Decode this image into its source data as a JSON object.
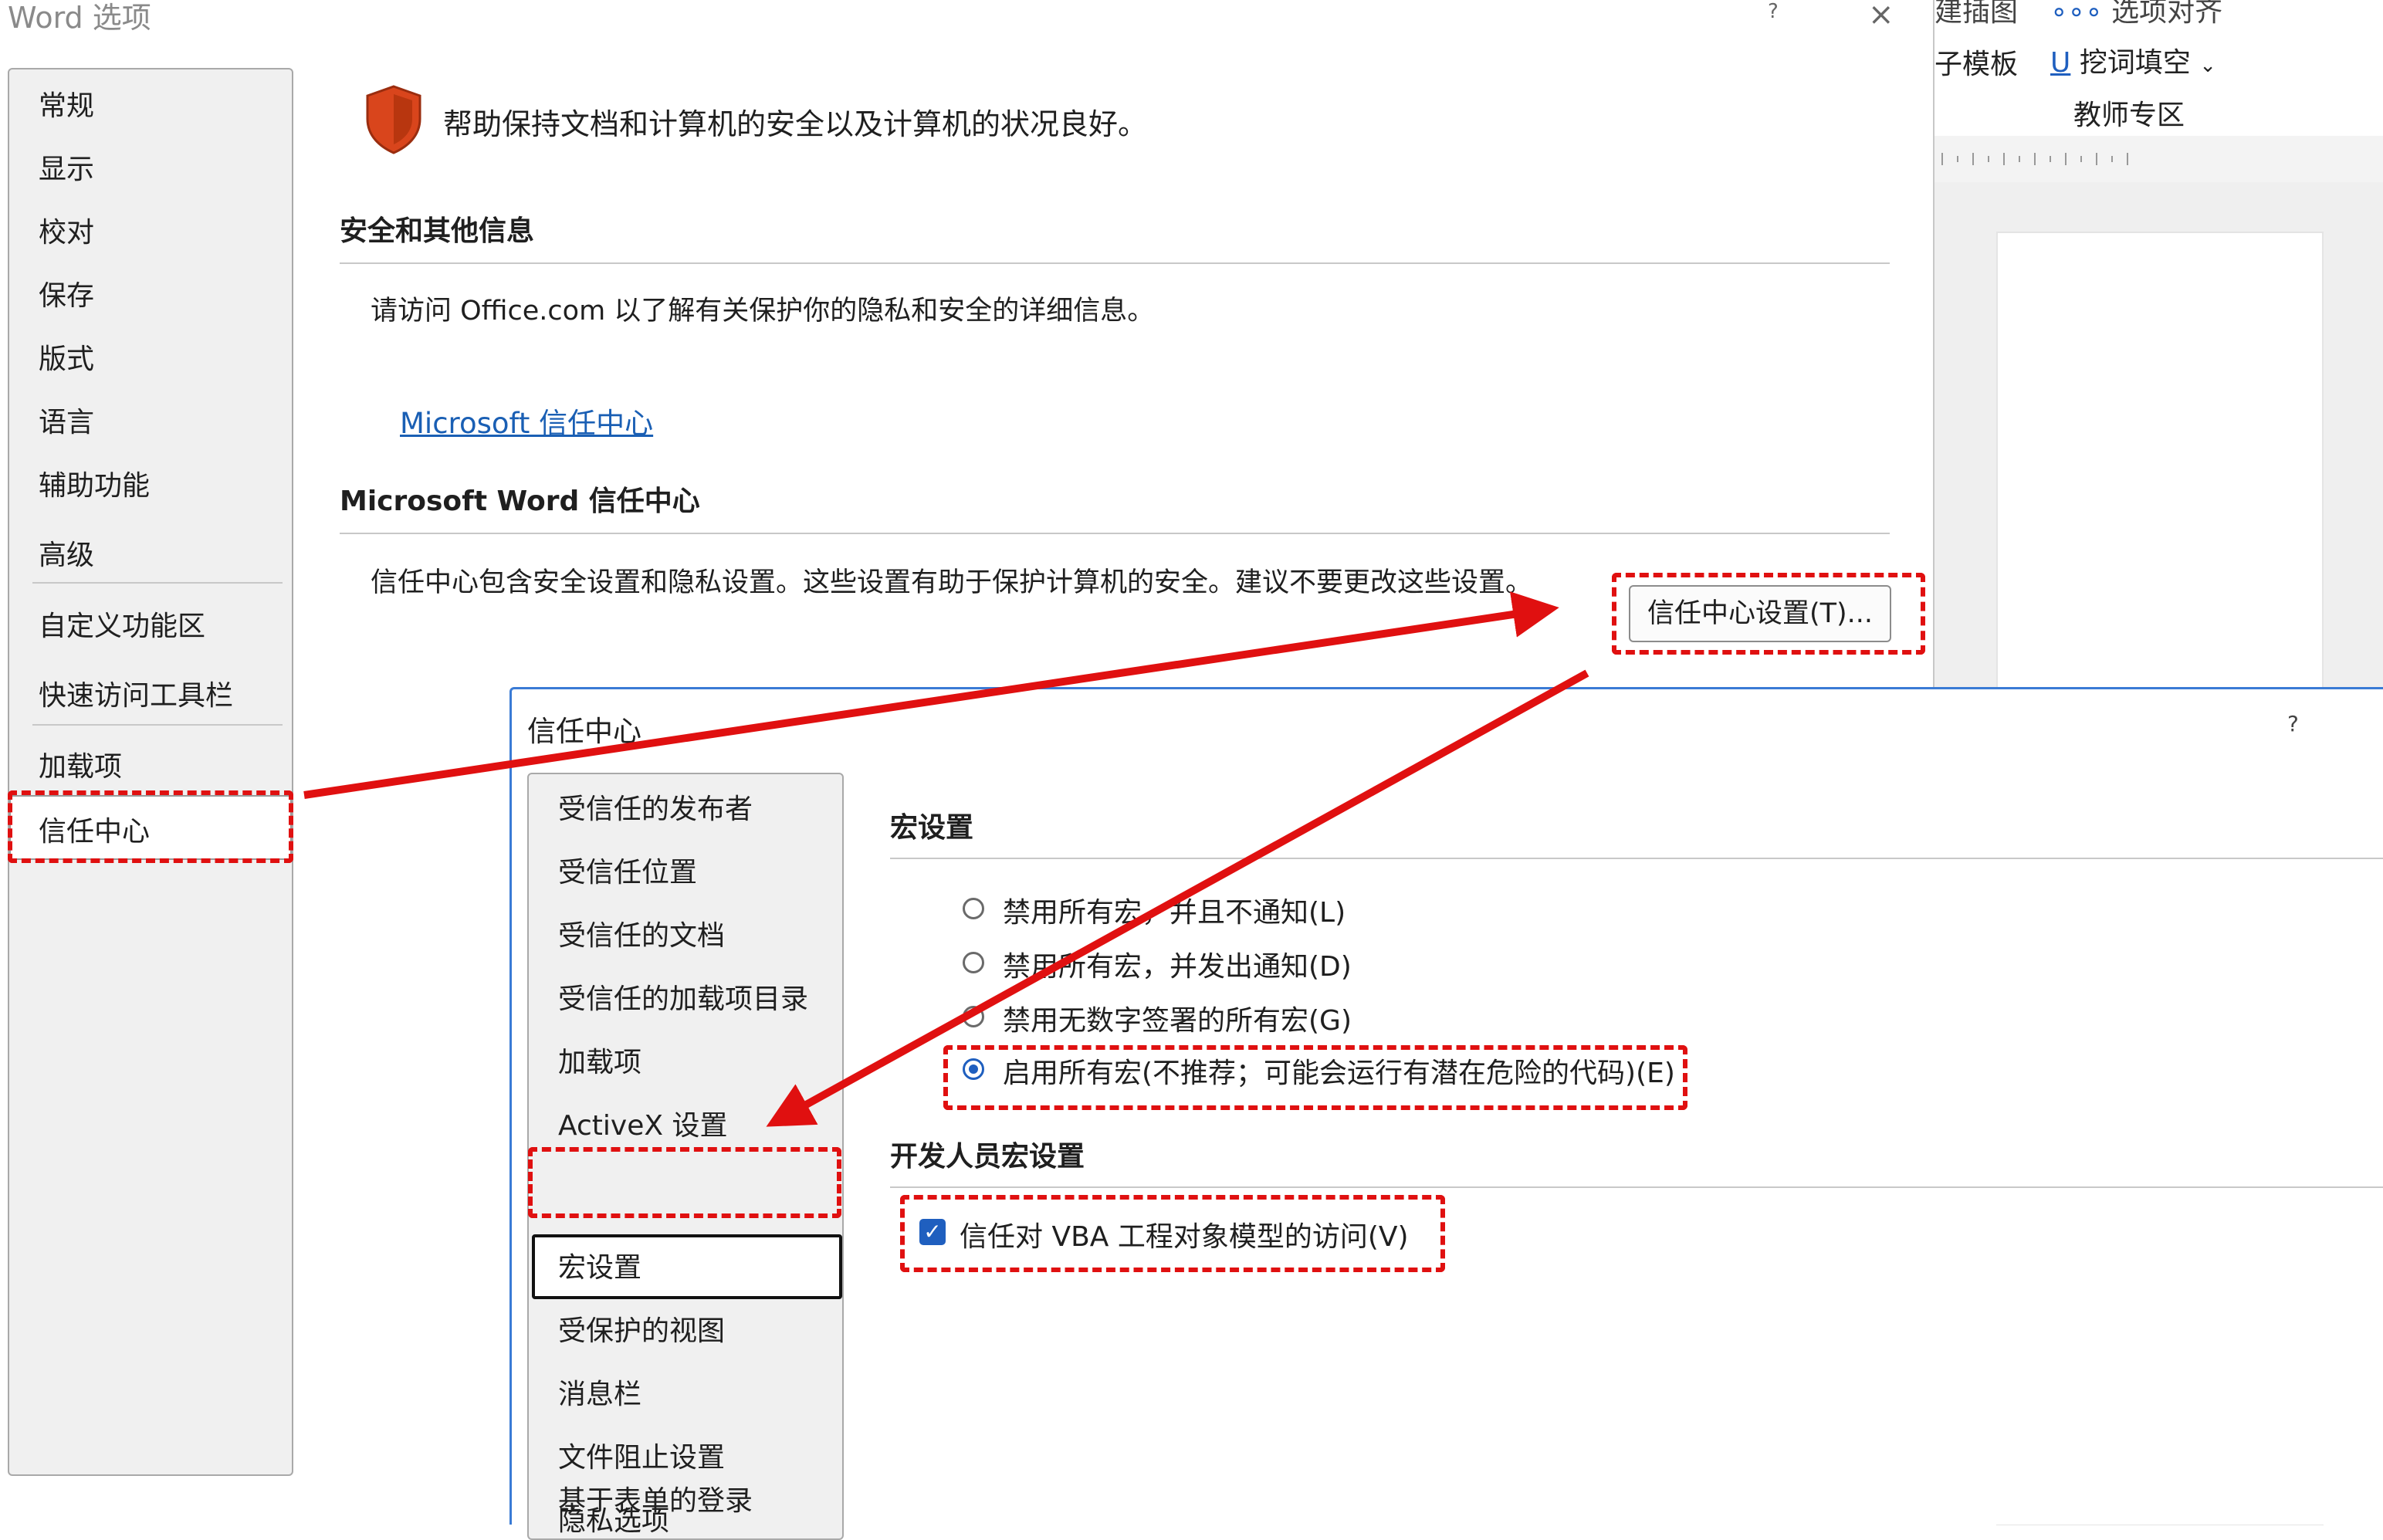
{
  "word_options": {
    "title": "Word 选项",
    "help": "?",
    "close": "×",
    "nav": [
      {
        "label": "常规"
      },
      {
        "label": "显示"
      },
      {
        "label": "校对"
      },
      {
        "label": "保存"
      },
      {
        "label": "版式"
      },
      {
        "label": "语言"
      },
      {
        "label": "辅助功能"
      },
      {
        "label": "高级"
      },
      {
        "label": "自定义功能区"
      },
      {
        "label": "快速访问工具栏"
      },
      {
        "label": "加载项"
      },
      {
        "label": "信任中心"
      }
    ],
    "intro": "帮助保持文档和计算机的安全以及计算机的状况良好。",
    "section1_heading": "安全和其他信息",
    "section1_text": "请访问 Office.com  以了解有关保护你的隐私和安全的详细信息。",
    "ms_link": "Microsoft 信任中心",
    "section2_heading": "Microsoft Word 信任中心",
    "section2_text": "信任中心包含安全设置和隐私设置。这些设置有助于保护计算机的安全。建议不要更改这些设置。",
    "settings_button": "信任中心设置(T)..."
  },
  "ribbon": {
    "top_cut": "建插图",
    "top_cut2": "选项对齐",
    "item1": "子模板",
    "item2": "挖词填空",
    "group": "教师专区"
  },
  "trust_center": {
    "title": "信任中心",
    "help": "?",
    "nav": [
      {
        "label": "受信任的发布者"
      },
      {
        "label": "受信任位置"
      },
      {
        "label": "受信任的文档"
      },
      {
        "label": "受信任的加载项目录"
      },
      {
        "label": "加载项"
      },
      {
        "label": "ActiveX 设置"
      },
      {
        "label": "宏设置"
      },
      {
        "label": "受保护的视图"
      },
      {
        "label": "消息栏"
      },
      {
        "label": "文件阻止设置"
      },
      {
        "label": "隐私选项"
      },
      {
        "label": "基于表单的登录"
      }
    ],
    "macro_heading": "宏设置",
    "options": [
      {
        "label": "禁用所有宏，并且不通知(L)",
        "checked": false
      },
      {
        "label": "禁用所有宏，并发出通知(D)",
        "checked": false
      },
      {
        "label": "禁用无数字签署的所有宏(G)",
        "checked": false
      },
      {
        "label": "启用所有宏(不推荐；可能会运行有潜在危险的代码)(E)",
        "checked": true
      }
    ],
    "dev_heading": "开发人员宏设置",
    "vba_label": "信任对 VBA 工程对象模型的访问(V)",
    "vba_checked": true
  },
  "colors": {
    "annotation": "#e01010",
    "accent": "#1f5fbf",
    "link": "#1a5fb4",
    "shield": "#d9451c"
  }
}
